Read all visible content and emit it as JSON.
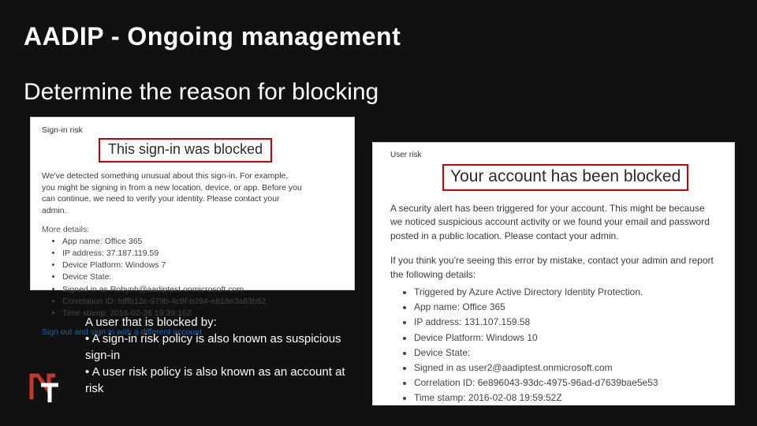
{
  "title": "AADIP - Ongoing management",
  "subtitle": "Determine the reason for blocking",
  "left": {
    "label": "Sign-in risk",
    "heading": "This sign-in was blocked",
    "desc": "We've detected something unusual about this sign-in. For example, you might be signing in from a new location, device, or app. Before you can continue, we need to verify your identity. Please contact your admin.",
    "more": "More details:",
    "items": [
      "App name: Office 365",
      "IP address: 37.187.119.59",
      "Device Platform: Windows 7",
      "Device State:",
      "Signed in as Robynh@aadiptest.onmicrosoft.com",
      "Correlation ID: fdffb12c-979b-4c9f-b294-e818e3a83b62",
      "Time stamp: 2016-02-26 19:39:16Z"
    ],
    "link": "Sign out and sign in with a different account"
  },
  "right": {
    "label": "User risk",
    "heading": "Your account has been blocked",
    "desc": "A security alert has been triggered for your account. This might be because we noticed suspicious account activity or we found your email and password posted in a public location. Please contact your admin.",
    "desc2": "If you think you're seeing this error by mistake, contact your admin and report the following details:",
    "items": [
      "Triggered by Azure Active Directory Identity Protection.",
      "App name: Office 365",
      "IP address: 131.107.159.58",
      "Device Platform: Windows 10",
      "Device State:",
      "Signed in as user2@aadiptest.onmicrosoft.com",
      "Correlation ID: 6e896043-93dc-4975-96ad-d7639bae5e53",
      "Time stamp: 2016-02-08 19:59:52Z"
    ]
  },
  "notes": {
    "line1": "A user that is blocked by:",
    "line2": "• A sign-in risk policy is also known as suspicious sign-in",
    "line3": "• A user risk policy is also known as an account at risk"
  }
}
